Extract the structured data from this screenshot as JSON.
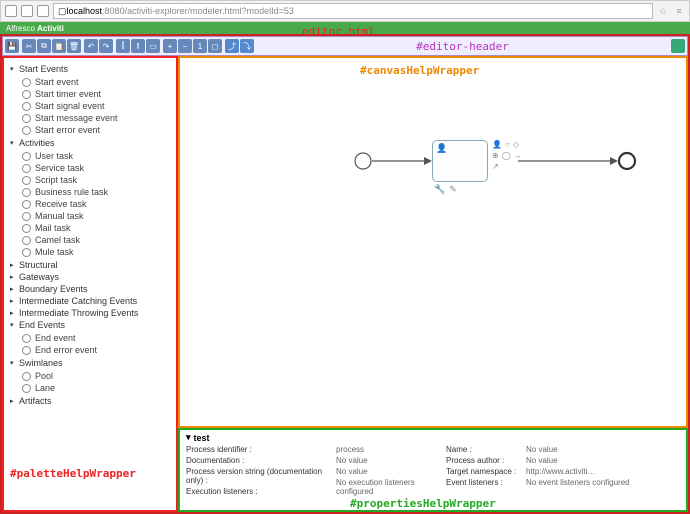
{
  "browser": {
    "host": "localhost",
    "rest": ":8080/activiti-explorer/modeler.html?modelId=53"
  },
  "brand": {
    "a": "Alfresco",
    "b": "Activiti"
  },
  "labels": {
    "editor": "editor.html",
    "header": "#editor-header",
    "canvas": "#canvasHelpWrapper",
    "palette": "#paletteHelpWrapper",
    "props": "#propertiesHelpWrapper"
  },
  "palette": {
    "startEvents": {
      "label": "Start Events",
      "open": true,
      "items": [
        {
          "label": "Start event"
        },
        {
          "label": "Start timer event"
        },
        {
          "label": "Start signal event"
        },
        {
          "label": "Start message event"
        },
        {
          "label": "Start error event"
        }
      ]
    },
    "activities": {
      "label": "Activities",
      "open": true,
      "items": [
        {
          "label": "User task"
        },
        {
          "label": "Service task"
        },
        {
          "label": "Script task"
        },
        {
          "label": "Business rule task"
        },
        {
          "label": "Receive task"
        },
        {
          "label": "Manual task"
        },
        {
          "label": "Mail task"
        },
        {
          "label": "Camel task"
        },
        {
          "label": "Mule task"
        }
      ]
    },
    "structural": {
      "label": "Structural",
      "open": false
    },
    "gateways": {
      "label": "Gateways",
      "open": false
    },
    "boundary": {
      "label": "Boundary Events",
      "open": false
    },
    "catching": {
      "label": "Intermediate Catching Events",
      "open": false
    },
    "throwing": {
      "label": "Intermediate Throwing Events",
      "open": false
    },
    "endEvents": {
      "label": "End Events",
      "open": true,
      "items": [
        {
          "label": "End event"
        },
        {
          "label": "End error event"
        }
      ]
    },
    "swimlanes": {
      "label": "Swimlanes",
      "open": true,
      "items": [
        {
          "label": "Pool"
        },
        {
          "label": "Lane"
        }
      ]
    },
    "artifacts": {
      "label": "Artifacts",
      "open": false
    }
  },
  "properties": {
    "title": "test",
    "rows": [
      {
        "k": "Process identifier :",
        "v": "process"
      },
      {
        "k": "Documentation :",
        "v": "No value"
      },
      {
        "k": "Process version string (documentation only) :",
        "v": "No value"
      },
      {
        "k": "Execution listeners :",
        "v": "No execution listeners configured"
      },
      {
        "k": "Name :",
        "v": "No value"
      },
      {
        "k": "Process author :",
        "v": "No value"
      },
      {
        "k": "Target namespace :",
        "v": "http://www.activiti…"
      },
      {
        "k": "Event listeners :",
        "v": "No event listeners configured"
      }
    ]
  },
  "colors": {
    "brand": "#4aa94a",
    "red": "#e22",
    "orange": "#e80",
    "green": "#2a2",
    "magenta": "#b3b"
  }
}
